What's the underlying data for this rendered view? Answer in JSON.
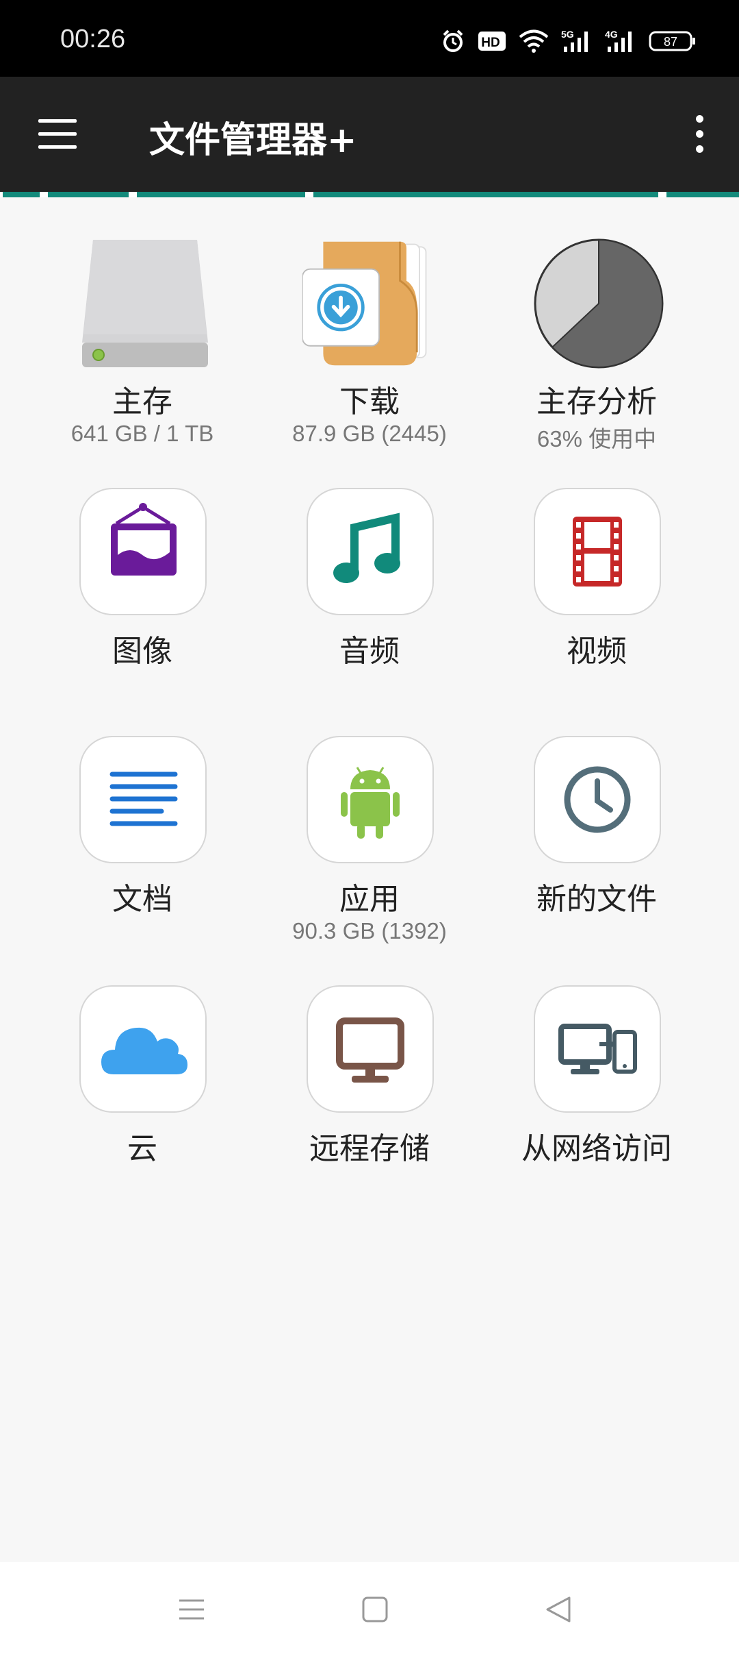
{
  "status_bar": {
    "time": "00:26",
    "hd_label": "HD",
    "network_5g": "5G",
    "network_4g": "4G",
    "battery": "87",
    "icons": [
      "alarm-icon",
      "hd-icon",
      "wifi-icon",
      "signal-5g-icon",
      "signal-4g-icon",
      "battery-icon"
    ]
  },
  "app_bar": {
    "title": "文件管理器+",
    "menu_icon": "hamburger-menu-icon",
    "more_icon": "more-vert-icon"
  },
  "colors": {
    "app_bar": "#222222",
    "accent": "#138a7b",
    "background": "#f7f7f7"
  },
  "tiles": [
    {
      "label": "主存",
      "sub": "641 GB / 1 TB",
      "icon": "hard-drive-icon"
    },
    {
      "label": "下载",
      "sub": "87.9 GB (2445)",
      "icon": "download-folder-icon"
    },
    {
      "label": "主存分析",
      "sub": "63% 使用中",
      "icon": "storage-pie-icon",
      "used_fraction": 0.63
    },
    {
      "label": "图像",
      "sub": "",
      "icon": "image-frame-icon"
    },
    {
      "label": "音频",
      "sub": "",
      "icon": "music-note-icon"
    },
    {
      "label": "视频",
      "sub": "",
      "icon": "film-strip-icon"
    },
    {
      "label": "文档",
      "sub": "",
      "icon": "document-lines-icon"
    },
    {
      "label": "应用",
      "sub": "90.3 GB (1392)",
      "icon": "android-icon"
    },
    {
      "label": "新的文件",
      "sub": "",
      "icon": "clock-icon"
    },
    {
      "label": "云",
      "sub": "",
      "icon": "cloud-icon"
    },
    {
      "label": "远程存储",
      "sub": "",
      "icon": "monitor-icon"
    },
    {
      "label": "从网络访问",
      "sub": "",
      "icon": "devices-icon"
    }
  ],
  "nav_bar": {
    "icons": [
      "recents-icon",
      "home-icon",
      "back-icon"
    ]
  }
}
